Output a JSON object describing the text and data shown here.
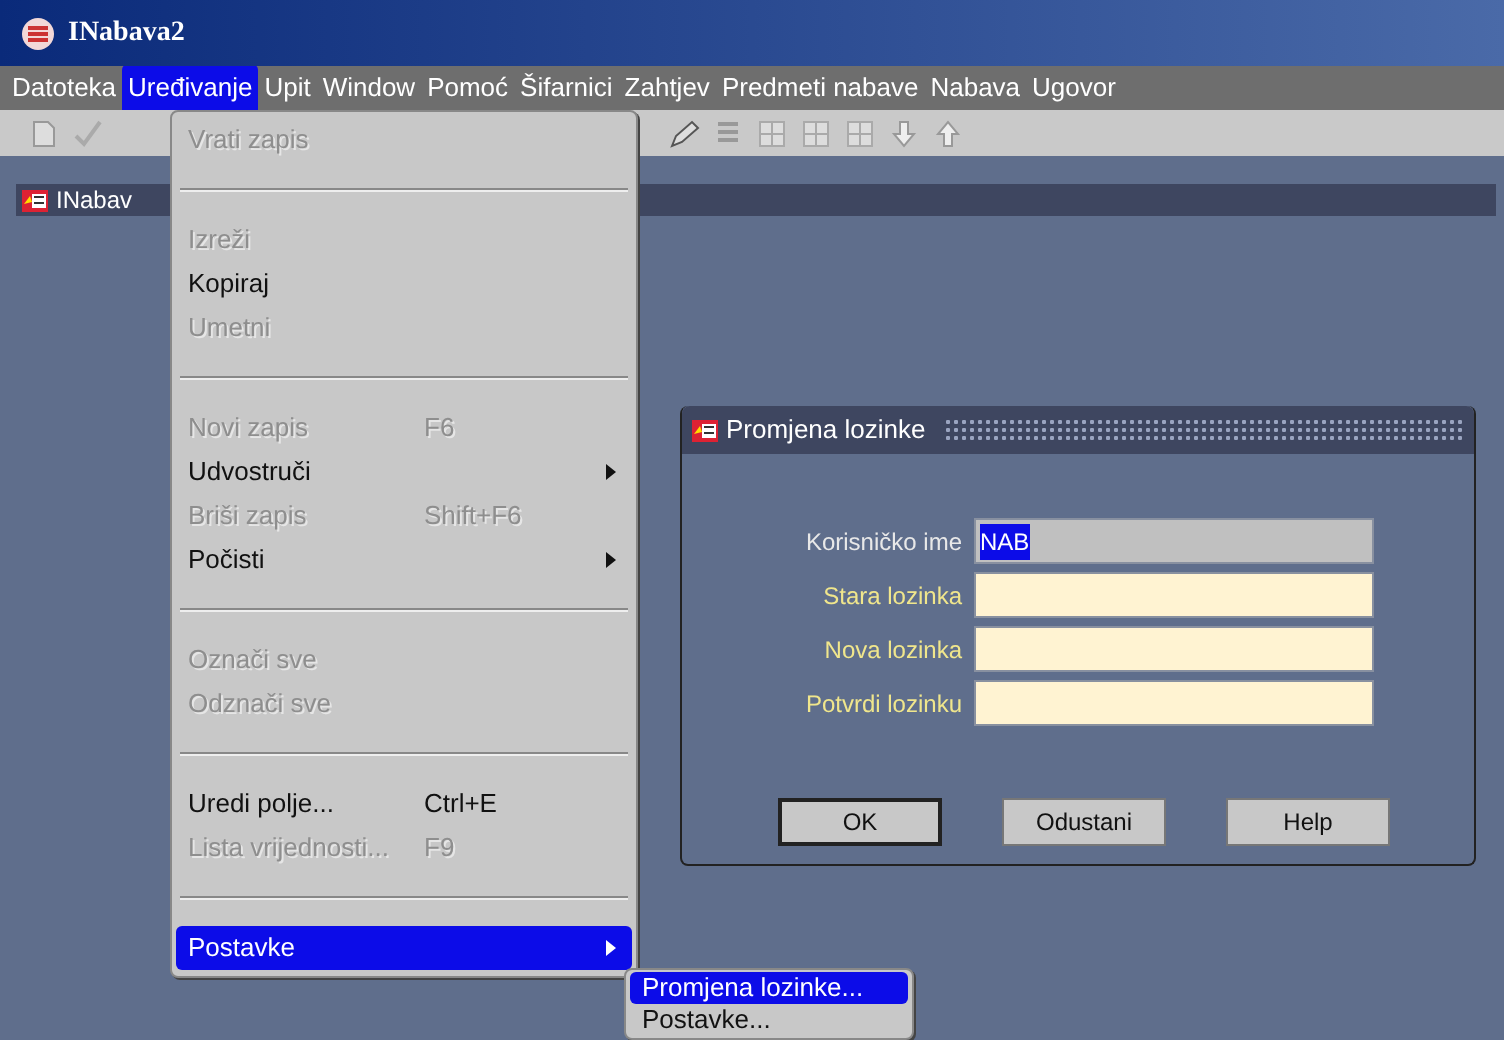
{
  "window": {
    "title": "INabava2"
  },
  "menu_bar": [
    {
      "label": "Datoteka",
      "selected": false
    },
    {
      "label": "Uređivanje",
      "selected": true
    },
    {
      "label": "Upit",
      "selected": false
    },
    {
      "label": "Window",
      "selected": false
    },
    {
      "label": "Pomoć",
      "selected": false
    },
    {
      "label": "Šifarnici",
      "selected": false
    },
    {
      "label": "Zahtjev",
      "selected": false
    },
    {
      "label": "Predmeti nabave",
      "selected": false
    },
    {
      "label": "Nabava",
      "selected": false
    },
    {
      "label": "Ugovor",
      "selected": false
    }
  ],
  "inner_window": {
    "title": "INabav"
  },
  "edit_menu": [
    {
      "kind": "item",
      "label": "Vrati zapis",
      "disabled": true,
      "selected": false
    },
    {
      "kind": "separator"
    },
    {
      "kind": "item",
      "label": "Izreži",
      "disabled": true,
      "selected": false
    },
    {
      "kind": "item",
      "label": "Kopiraj",
      "disabled": false,
      "selected": false
    },
    {
      "kind": "item",
      "label": "Umetni",
      "disabled": true,
      "selected": false
    },
    {
      "kind": "separator"
    },
    {
      "kind": "item",
      "label": "Novi zapis",
      "shortcut": "F6",
      "disabled": true,
      "selected": false
    },
    {
      "kind": "item",
      "label": "Udvostruči",
      "disabled": false,
      "submenu": true,
      "selected": false
    },
    {
      "kind": "item",
      "label": "Briši zapis",
      "shortcut": "Shift+F6",
      "disabled": true,
      "selected": false
    },
    {
      "kind": "item",
      "label": "Počisti",
      "disabled": false,
      "submenu": true,
      "selected": false
    },
    {
      "kind": "separator"
    },
    {
      "kind": "item",
      "label": "Označi sve",
      "disabled": true,
      "selected": false
    },
    {
      "kind": "item",
      "label": "Odznači sve",
      "disabled": true,
      "selected": false
    },
    {
      "kind": "separator"
    },
    {
      "kind": "item",
      "label": "Uredi polje...",
      "shortcut": "Ctrl+E",
      "disabled": false,
      "selected": false
    },
    {
      "kind": "item",
      "label": "Lista vrijednosti...",
      "shortcut": "F9",
      "disabled": true,
      "selected": false
    },
    {
      "kind": "separator"
    },
    {
      "kind": "item",
      "label": "Postavke",
      "disabled": false,
      "submenu": true,
      "selected": true
    }
  ],
  "submenu": [
    {
      "label": "Promjena lozinke...",
      "selected": true
    },
    {
      "label": "Postavke...",
      "selected": false
    }
  ],
  "dialog": {
    "title": "Promjena lozinke",
    "fields": [
      {
        "label": "Korisničko ime",
        "value": "NAB",
        "kind": "readonly"
      },
      {
        "label": "Stara lozinka",
        "kind": "input"
      },
      {
        "label": "Nova lozinka",
        "kind": "input"
      },
      {
        "label": "Potvrdi lozinku",
        "kind": "input"
      }
    ],
    "buttons": [
      {
        "label": "OK",
        "default": true
      },
      {
        "label": "Odustani",
        "default": false
      },
      {
        "label": "Help",
        "default": false
      }
    ]
  }
}
